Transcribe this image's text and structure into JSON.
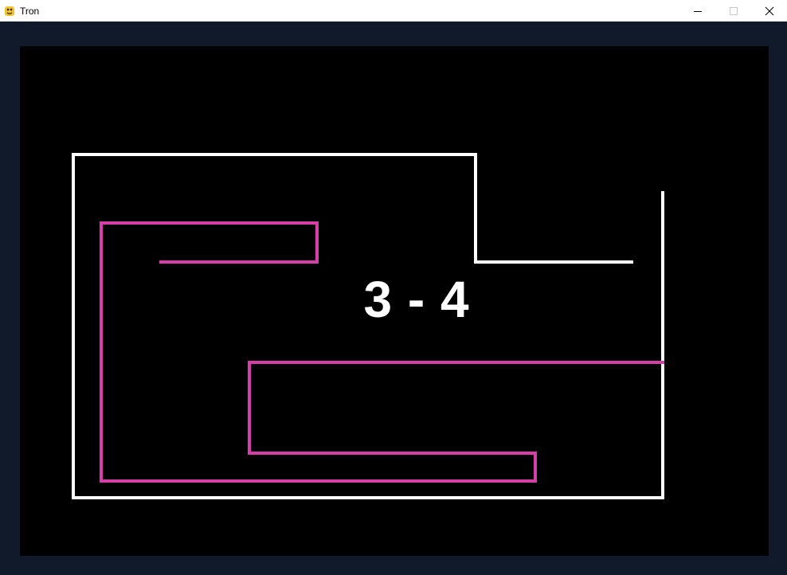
{
  "window": {
    "title": "Tron",
    "controls": [
      "minimize",
      "maximize",
      "close"
    ]
  },
  "game": {
    "score_text": "3 - 4",
    "player1": {
      "score": 3,
      "color": "#ffffff"
    },
    "player2": {
      "score": 4,
      "color": "#d63fa8"
    },
    "background": "#000000",
    "frame_color": "#111a2a"
  },
  "icons": {
    "app": "python-icon",
    "minimize": "minimize-icon",
    "maximize": "maximize-icon",
    "close": "close-icon"
  }
}
